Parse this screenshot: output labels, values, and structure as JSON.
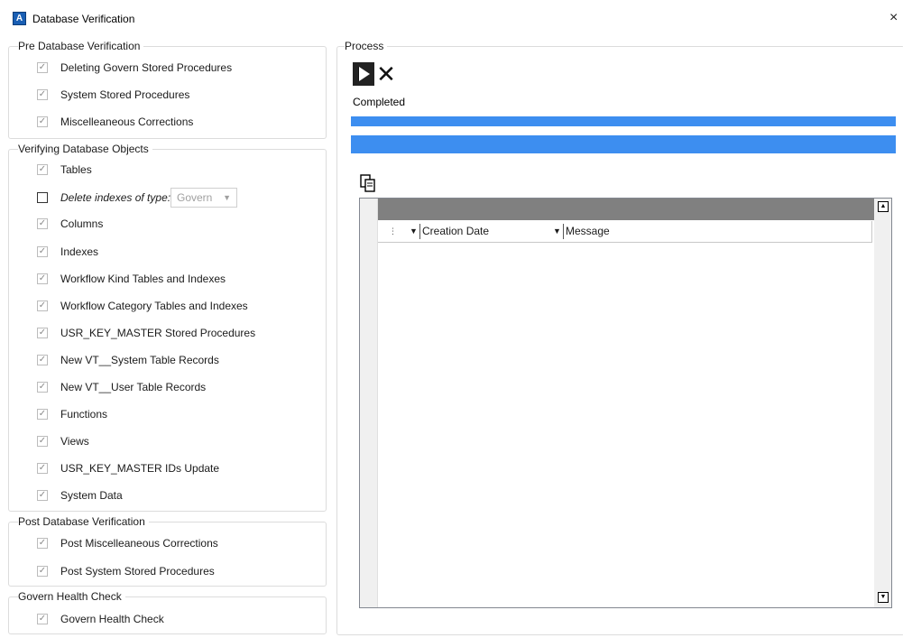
{
  "window": {
    "title": "Database Verification",
    "icon_letter": "A",
    "close_glyph": "×"
  },
  "groups": {
    "pre": {
      "title": "Pre Database Verification",
      "items": [
        {
          "label": "Deleting Govern Stored Procedures",
          "checked": true
        },
        {
          "label": "System Stored Procedures",
          "checked": true
        },
        {
          "label": "Miscelleaneous Corrections",
          "checked": true
        }
      ]
    },
    "verify": {
      "title": "Verifying Database Objects",
      "items": [
        {
          "label": "Tables",
          "checked": true
        },
        {
          "label": "Delete indexes of type:",
          "checked": false,
          "italic": true
        },
        {
          "label": "Columns",
          "checked": true
        },
        {
          "label": "Indexes",
          "checked": true
        },
        {
          "label": "Workflow Kind Tables and Indexes",
          "checked": true
        },
        {
          "label": "Workflow Category Tables and Indexes",
          "checked": true
        },
        {
          "label": "USR_KEY_MASTER Stored Procedures",
          "checked": true
        },
        {
          "label": "New VT__System Table Records",
          "checked": true
        },
        {
          "label": "New VT__User Table Records",
          "checked": true
        },
        {
          "label": "Functions",
          "checked": true
        },
        {
          "label": "Views",
          "checked": true
        },
        {
          "label": "USR_KEY_MASTER IDs Update",
          "checked": true
        },
        {
          "label": "System Data",
          "checked": true
        }
      ],
      "index_type": {
        "value": "Govern",
        "enabled": false
      }
    },
    "post": {
      "title": "Post Database Verification",
      "items": [
        {
          "label": "Post Miscelleaneous Corrections",
          "checked": true
        },
        {
          "label": "Post System Stored Procedures",
          "checked": true
        }
      ]
    },
    "health": {
      "title": "Govern Health Check",
      "items": [
        {
          "label": "Govern Health Check",
          "checked": true
        }
      ]
    }
  },
  "process": {
    "title": "Process",
    "status": "Completed",
    "progress_overall": 1.0,
    "progress_step": 1.0,
    "grid": {
      "columns": [
        "Creation Date",
        "Message"
      ],
      "rows": []
    }
  },
  "icons": {
    "run": "play-icon",
    "stop": "stop-x-icon",
    "copy": "copy-icon",
    "check": "checkmark-icon",
    "dropdown": "chevron-down-icon"
  },
  "colors": {
    "progress_fill": "#3d8ef0",
    "grid_groupbar": "#808080",
    "app_icon": "#1a5fb4"
  }
}
